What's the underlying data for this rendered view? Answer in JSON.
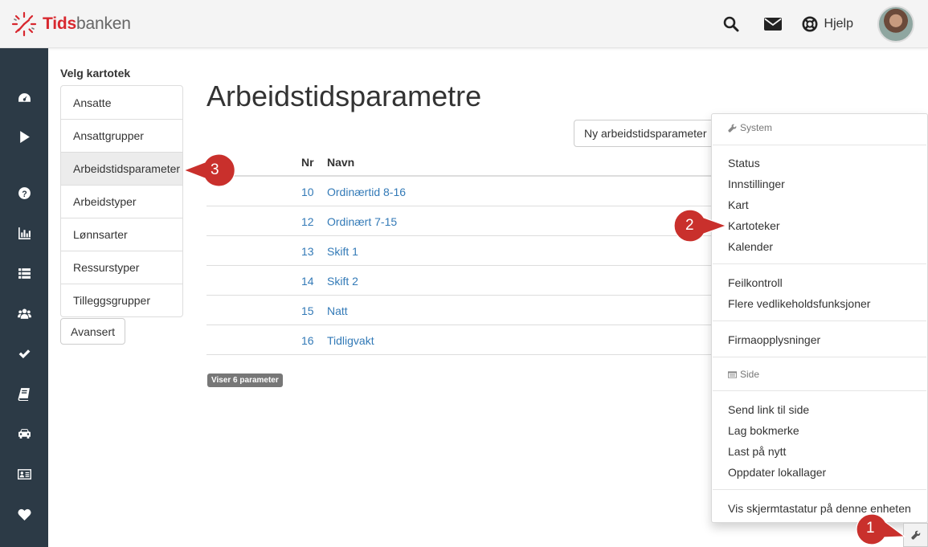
{
  "app": {
    "logo_part1": "Tids",
    "logo_part2": "banken"
  },
  "header": {
    "help_label": "Hjelp"
  },
  "sidebar": {
    "icons": [
      "dashboard-icon",
      "play-icon",
      "question-icon",
      "bar-chart-icon",
      "list-icon",
      "users-icon",
      "check-icon",
      "book-icon",
      "car-icon",
      "id-card-icon",
      "heart-icon"
    ]
  },
  "panel": {
    "title": "Velg kartotek",
    "items": [
      {
        "label": "Ansatte",
        "active": false
      },
      {
        "label": "Ansattgrupper",
        "active": false
      },
      {
        "label": "Arbeidstidsparameter",
        "active": true
      },
      {
        "label": "Arbeidstyper",
        "active": false
      },
      {
        "label": "Lønnsarter",
        "active": false
      },
      {
        "label": "Ressurstyper",
        "active": false
      },
      {
        "label": "Tilleggsgrupper",
        "active": false
      }
    ],
    "advanced_label": "Avansert"
  },
  "main": {
    "title": "Arbeidstidsparametre",
    "new_button": "Ny arbeidstidsparameter",
    "columns": [
      "Nr",
      "Navn"
    ],
    "rows": [
      {
        "nr": "10",
        "name": "Ordinærtid 8-16"
      },
      {
        "nr": "12",
        "name": "Ordinært 7-15"
      },
      {
        "nr": "13",
        "name": "Skift 1"
      },
      {
        "nr": "14",
        "name": "Skift 2"
      },
      {
        "nr": "15",
        "name": "Natt"
      },
      {
        "nr": "16",
        "name": "Tidligvakt"
      }
    ],
    "count_badge": "Viser 6 parameter"
  },
  "dropdown": {
    "system_header": "System",
    "group1": [
      "Status",
      "Innstillinger",
      "Kart",
      "Kartoteker",
      "Kalender"
    ],
    "group2": [
      "Feilkontroll",
      "Flere vedlikeholdsfunksjoner"
    ],
    "group3": [
      "Firmaopplysninger"
    ],
    "side_header": "Side",
    "group4": [
      "Send link til side",
      "Lag bokmerke",
      "Last på nytt",
      "Oppdater lokallager"
    ],
    "group5": [
      "Vis skjermtastatur på denne enheten"
    ]
  },
  "callouts": [
    "1",
    "2",
    "3"
  ],
  "colors": {
    "sidebar": "#2c3a46",
    "brand_red": "#d8282f",
    "link": "#337ab7",
    "callout": "#c9302c"
  }
}
